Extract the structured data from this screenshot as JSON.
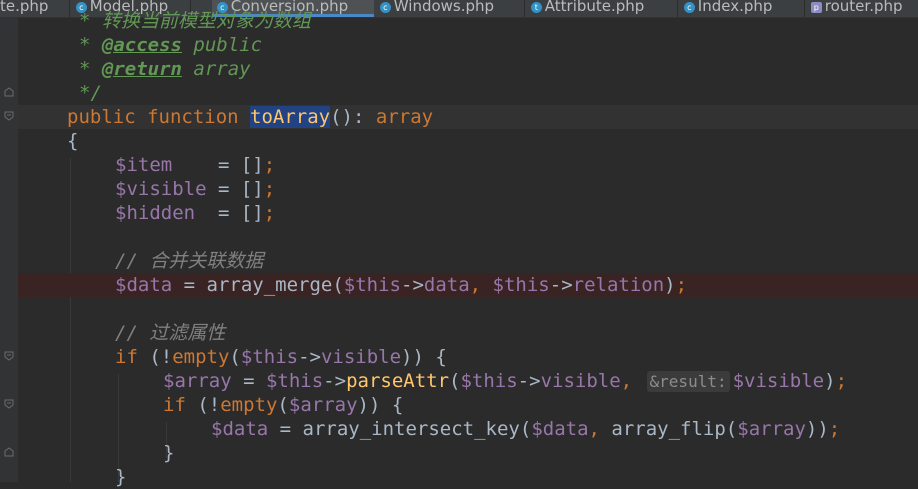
{
  "tabs": [
    {
      "label": "te.php"
    },
    {
      "label": "Model.php"
    },
    {
      "label": "Conversion.php"
    },
    {
      "label": "Windows.php"
    },
    {
      "label": "Attribute.php"
    },
    {
      "label": "Index.php"
    },
    {
      "label": "router.php"
    }
  ],
  "lines": {
    "l0": "* 转换当前模型对象为数组",
    "l1_star": "* ",
    "l1_tag": "@access",
    "l1_rest": " public",
    "l2_star": "* ",
    "l2_tag": "@return",
    "l2_rest": " array",
    "l3": "*/",
    "l4_public": "public",
    "l4_function": " function ",
    "l4_name": "toArray",
    "l4_paren": "(): ",
    "l4_type": "array",
    "l5": "{",
    "l6_var": "$item",
    "l6_rest": "    = []",
    "l7_var": "$visible",
    "l7_rest": " = []",
    "l8_var": "$hidden",
    "l8_rest": "  = []",
    "semi": ";",
    "l10": "// 合并关联数据",
    "l11_var": "$data",
    "l11_mid": " = array_merge(",
    "l11_this1": "$this",
    "l11_arrow1": "->",
    "l11_prop1": "data",
    "l11_comma": ", ",
    "l11_this2": "$this",
    "l11_arrow2": "->",
    "l11_prop2": "relation",
    "l11_close": ")",
    "l13": "// 过滤属性",
    "l14_if": "if",
    "l14_a": " (!",
    "l14_empty": "empty",
    "l14_b": "(",
    "l14_this": "$this",
    "l14_arrow": "->",
    "l14_prop": "visible",
    "l14_c": ")) {",
    "l15_var": "$array",
    "l15_eq": " = ",
    "l15_this": "$this",
    "l15_arrow": "->",
    "l15_method": "parseAttr",
    "l15_open": "(",
    "l15_this2": "$this",
    "l15_arrow2": "->",
    "l15_prop": "visible",
    "l15_comma": ", ",
    "l15_hint": "&result:",
    "l15_var2": "$visible",
    "l15_close": ")",
    "l16_if": "if",
    "l16_a": " (!",
    "l16_empty": "empty",
    "l16_b": "(",
    "l16_var": "$array",
    "l16_c": ")) {",
    "l17_var": "$data",
    "l17_mid": " = array_intersect_key(",
    "l17_var2": "$data",
    "l17_comma": ", ",
    "l17_flip": "array_flip(",
    "l17_var3": "$array",
    "l17_close": "))",
    "l18": "}",
    "l19": "}"
  }
}
